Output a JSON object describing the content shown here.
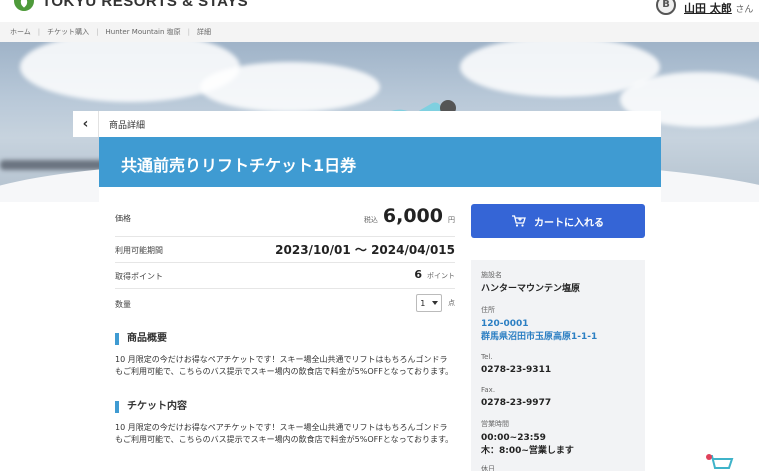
{
  "header": {
    "brand": "TOKYU RESORTS & STAYS",
    "avatar_text": "B",
    "user_name": "山田 太郎",
    "user_suffix": "さん"
  },
  "breadcrumb": [
    "ホーム",
    "チケット購入",
    "Hunter Mountain 塩原",
    "詳細"
  ],
  "product": {
    "back_label": "商品詳細",
    "title": "共通前売りリフトチケット1日券",
    "price_label": "価格",
    "tax_label": "税込",
    "price": "6,000",
    "yen": "円",
    "period_label": "利用可能期間",
    "period": "2023/10/01 ～ 2024/04/015",
    "points_label": "取得ポイント",
    "points": "6",
    "points_unit": "ポイント",
    "qty_label": "数量",
    "qty_value": "1",
    "qty_unit": "点",
    "overview_title": "商品概要",
    "overview_text": "10 月限定の今だけお得なペアチケットです！スキー場全山共通でリフトはもちろんゴンドラもご利用可能で、こちらのバス提示でスキー場内の飲食店で料金が5%OFFとなっております。",
    "content_title": "チケット内容",
    "content_text": "10 月限定の今だけお得なペアチケットです！スキー場全山共通でリフトはもちろんゴンドラもご利用可能で、こちらのバス提示でスキー場内の飲食店で料金が5%OFFとなっております。"
  },
  "cart": {
    "button_label": "カートに入れる"
  },
  "facility": {
    "name_label": "施設名",
    "name": "ハンターマウンテン塩原",
    "address_label": "住所",
    "postal": "120-0001",
    "address": "群馬県沼田市玉原高原1-1-1",
    "tel_label": "Tel.",
    "tel": "0278-23-9311",
    "fax_label": "Fax.",
    "fax": "0278-23-9977",
    "hours_label": "営業時間",
    "hours_1": "00:00~23:59",
    "hours_2": "木：8:00~営業します",
    "holiday_label": "休日"
  },
  "colors": {
    "title_bar": "#3f9bd2",
    "cart_button": "#3565d6",
    "link": "#2c7fc3"
  }
}
